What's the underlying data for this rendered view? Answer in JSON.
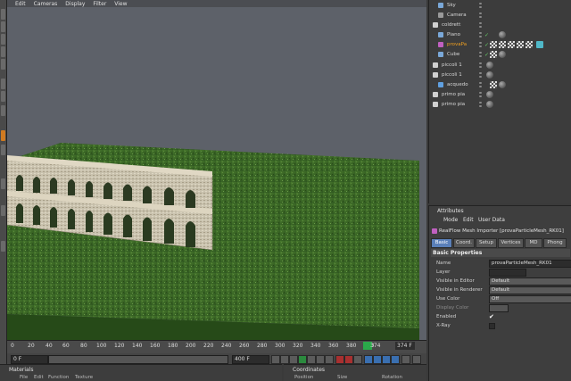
{
  "viewport": {
    "menu": [
      "Edit",
      "Cameras",
      "Display",
      "Filter",
      "View"
    ]
  },
  "objects": [
    {
      "name": "Sky",
      "icon_color": "#7aa8d8"
    },
    {
      "name": "Camera",
      "icon_color": "#9a9a9a"
    },
    {
      "name": "coldrett",
      "icon_color": "#d0d0d0"
    },
    {
      "name": "Piano",
      "icon_color": "#7aa8d8"
    },
    {
      "name": "provaPa",
      "icon_color": "#c060c0",
      "selected": true
    },
    {
      "name": "Cube",
      "icon_color": "#7aa8d8"
    },
    {
      "name": "piccoli 1",
      "icon_color": "#d0d0d0"
    },
    {
      "name": "piccoli 1",
      "icon_color": "#d0d0d0"
    },
    {
      "name": "acquedo",
      "icon_color": "#60a0e0"
    },
    {
      "name": "primo pia",
      "icon_color": "#d0d0d0"
    },
    {
      "name": "primo pia",
      "icon_color": "#d0d0d0"
    }
  ],
  "attributes": {
    "title": "Attributes",
    "menu": [
      "Mode",
      "Edit",
      "User Data"
    ],
    "object_title": "RealFlow Mesh Importer [provaParticleMesh_RK01]",
    "tabs": [
      "Basic",
      "Coord.",
      "Setup",
      "Vertices",
      "MD",
      "Phong"
    ],
    "section": "Basic Properties",
    "props": [
      {
        "label": "Name",
        "value": "provaParticleMesh_RK01",
        "kind": "text"
      },
      {
        "label": "Layer",
        "value": "",
        "kind": "text"
      },
      {
        "label": "Visible in Editor",
        "value": "Default",
        "kind": "drop"
      },
      {
        "label": "Visible in Renderer",
        "value": "Default",
        "kind": "drop"
      },
      {
        "label": "Use Color",
        "value": "Off",
        "kind": "drop"
      },
      {
        "label": "Display Color",
        "value": "",
        "kind": "dim"
      },
      {
        "label": "Enabled",
        "value": "✔",
        "kind": "check"
      },
      {
        "label": "X-Ray",
        "value": "",
        "kind": "box"
      }
    ]
  },
  "timeline": {
    "ticks": [
      "0",
      "20",
      "40",
      "60",
      "80",
      "100",
      "120",
      "140",
      "160",
      "180",
      "200",
      "220",
      "240",
      "260",
      "280",
      "300",
      "320",
      "340",
      "360",
      "380",
      "400"
    ],
    "current_marker": "374",
    "current_field": "374 F",
    "start_field": "0 F",
    "slider_field": "400 F",
    "end_field": "400 F"
  },
  "materials": {
    "title": "Materials",
    "menu": [
      "File",
      "Edit",
      "Function",
      "Texture"
    ]
  },
  "coordinates": {
    "title": "Coordinates",
    "columns": [
      "Position",
      "Size",
      "Rotation"
    ]
  },
  "colors": {
    "accent": "#f0a020",
    "active_tab": "#5a7fb8",
    "playhead": "#2aa84a",
    "grass": "#3f6b28"
  }
}
